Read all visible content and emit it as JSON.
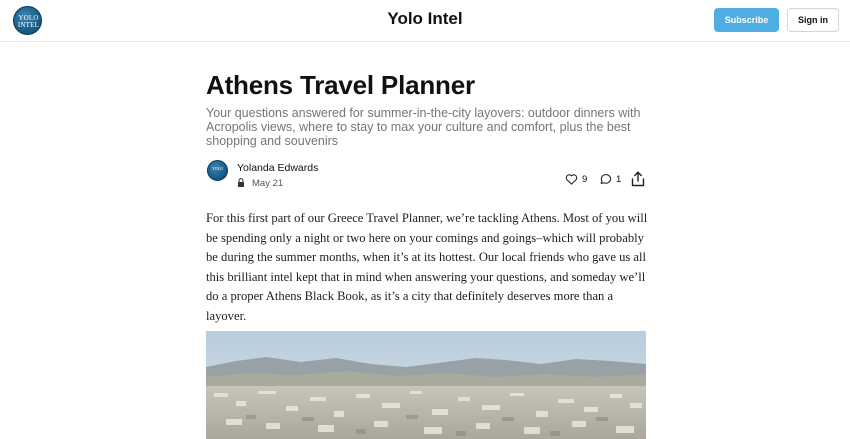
{
  "header": {
    "logo_text_line1": "YOLO",
    "logo_text_line2": "INTEL",
    "site_title": "Yolo Intel",
    "subscribe_label": "Subscribe",
    "signin_label": "Sign in",
    "accent_color": "#4eaee3"
  },
  "post": {
    "title": "Athens Travel Planner",
    "subtitle": "Your questions answered for summer-in-the-city layovers: outdoor dinners with Acropolis views, where to stay to max your culture and comfort, plus the best shopping and souvenirs",
    "author": "Yolanda Edwards",
    "date": "May 21",
    "likes": "9",
    "comments": "1",
    "body": "For this first part of our Greece Travel Planner, we’re tackling Athens. Most of you will be spending only a night or two here on your comings and goings–which will probably be during the summer months, when it’s at its hottest. Our local friends who gave us all this brilliant intel kept that in mind when answering your questions, and someday we’ll do a proper Athens Black Book, as it’s a city that definitely deserves more than a layover."
  },
  "icons": {
    "like": "heart-icon",
    "comment": "comment-bubble-icon",
    "share": "share-icon",
    "lock": "lock-icon"
  }
}
